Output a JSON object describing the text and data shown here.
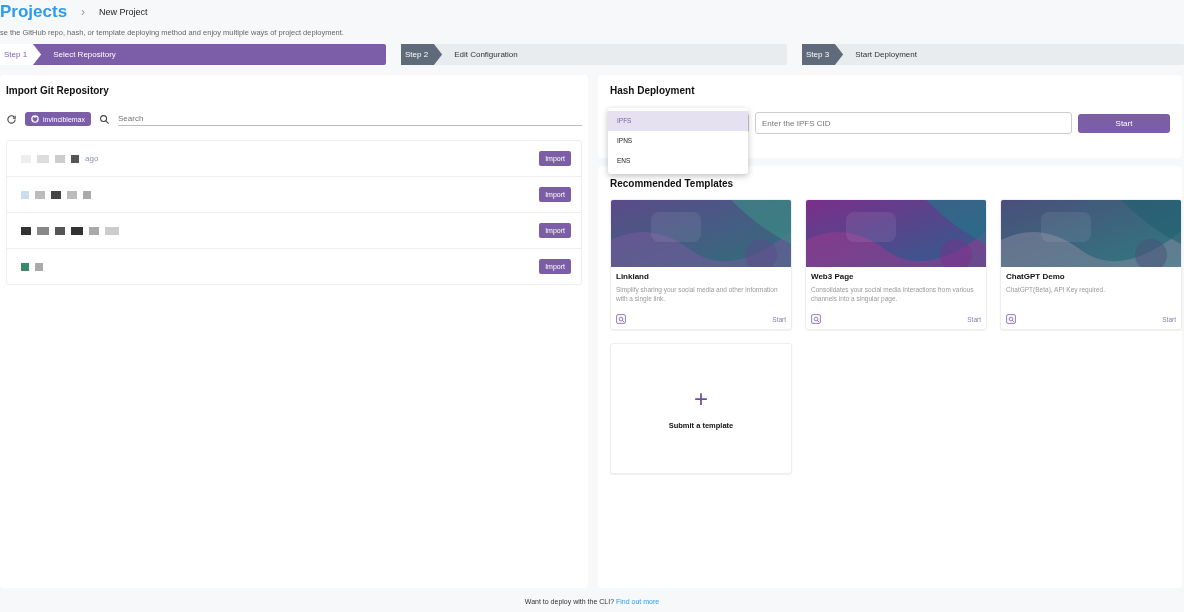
{
  "breadcrumb": {
    "root": "Projects",
    "separator": "›",
    "current": "New Project"
  },
  "subtitle": "se the GitHub repo, hash, or template deploying method and enjoy multiple ways of project deployment.",
  "steps": [
    {
      "label": "Step 1",
      "title": "Select Repository",
      "selected": true
    },
    {
      "label": "Step 2",
      "title": "Edit Configuration",
      "selected": false
    },
    {
      "label": "Step 3",
      "title": "Start Deployment",
      "selected": false
    }
  ],
  "import_panel": {
    "title": "Import Git Repository",
    "account": "invinciblemax",
    "search": {
      "placeholder": "Search"
    },
    "repos": [
      {
        "time": "ago",
        "button": "Import"
      },
      {
        "button": "Import"
      },
      {
        "button": "Import"
      },
      {
        "button": "Import"
      }
    ]
  },
  "hash_panel": {
    "title": "Hash Deployment",
    "input": {
      "placeholder": "Enter the IPFS CID"
    },
    "button": "Start",
    "dropdown": [
      {
        "label": "IPFS",
        "selected": true
      },
      {
        "label": "IPNS",
        "selected": false
      },
      {
        "label": "ENS",
        "selected": false
      }
    ]
  },
  "templates": {
    "title": "Recommended Templates",
    "items": [
      {
        "kind": "picture",
        "name": "Linkland",
        "description": "Simplify sharing your social media and other information with a single link.",
        "action": "Start"
      },
      {
        "kind": "picture",
        "name": "Web3 Page",
        "description": "Consolidates your social media interactions from various channels into a singular page.",
        "action": "Start"
      },
      {
        "kind": "picture",
        "name": "ChatGPT Demo",
        "description": "ChatGPT(Beta), API Key required.",
        "action": "Start"
      }
    ],
    "submit": {
      "icon": "+",
      "label": "Submit a template"
    }
  },
  "footer": {
    "text": "Want to deploy with the CLI?",
    "link": "Find out more"
  }
}
